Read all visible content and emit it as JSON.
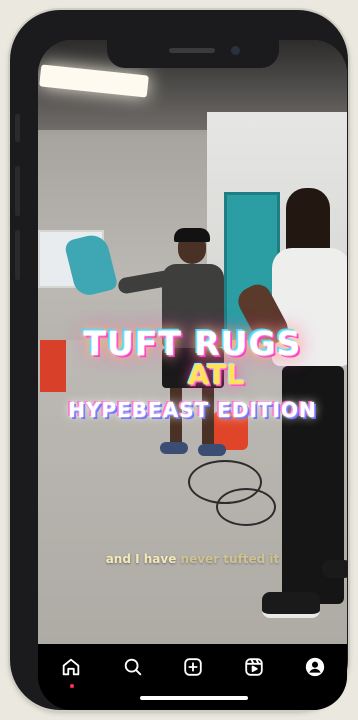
{
  "overlay": {
    "line1": "TUFT RUGS",
    "line2": "ATL",
    "line3": "HYPEBEAST EDITION"
  },
  "caption": {
    "spoken": "and I have",
    "upcoming": "never tufted it"
  },
  "nav": {
    "items": [
      {
        "icon": "home-icon",
        "active": true
      },
      {
        "icon": "search-icon"
      },
      {
        "icon": "create-icon"
      },
      {
        "icon": "reels-icon"
      },
      {
        "icon": "profile-icon"
      }
    ],
    "active_indicator_color": "#ff2d55"
  },
  "colors": {
    "frame": "#1b1b1d",
    "background": "#eae8df",
    "nav_bg": "#000000"
  }
}
